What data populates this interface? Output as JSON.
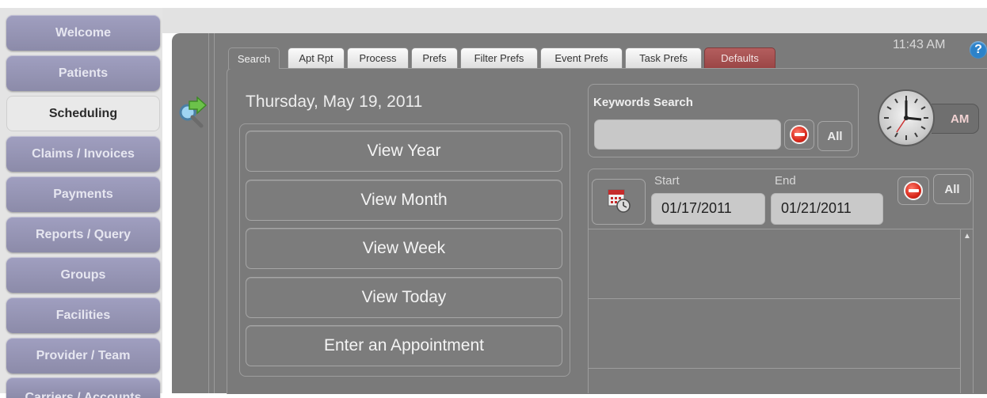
{
  "sidebar": {
    "items": [
      {
        "label": "Welcome"
      },
      {
        "label": "Patients"
      },
      {
        "label": "Scheduling"
      },
      {
        "label": "Claims / Invoices"
      },
      {
        "label": "Payments"
      },
      {
        "label": "Reports / Query"
      },
      {
        "label": "Groups"
      },
      {
        "label": "Facilities"
      },
      {
        "label": "Provider / Team"
      },
      {
        "label": "Carriers / Accounts"
      }
    ],
    "active": "Scheduling"
  },
  "header": {
    "time": "11:43 AM",
    "help_glyph": "?"
  },
  "tabs": [
    {
      "label": "Search"
    },
    {
      "label": "Apt Rpt"
    },
    {
      "label": "Process"
    },
    {
      "label": "Prefs"
    },
    {
      "label": "Filter Prefs"
    },
    {
      "label": "Event Prefs"
    },
    {
      "label": "Task Prefs"
    },
    {
      "label": "Defaults"
    }
  ],
  "main": {
    "date": "Thursday, May 19, 2011",
    "view_buttons": [
      "View Year",
      "View Month",
      "View Week",
      "View Today",
      "Enter an Appointment"
    ]
  },
  "keywords": {
    "label": "Keywords Search",
    "value": "",
    "all_label": "All"
  },
  "clock": {
    "ampm_label": "AM"
  },
  "range": {
    "start_label": "Start",
    "start_value": "01/17/2011",
    "end_label": "End",
    "end_value": "01/21/2011",
    "all_label": "All"
  },
  "colors": {
    "panel": "#7b7b7b",
    "nav_button": "#9b9aba",
    "active_nav": "#e9e9e9",
    "defaults_tab": "#a94f4f",
    "help": "#2d82c9"
  },
  "icons": [
    "search-arrow-icon",
    "help-icon",
    "minus-icon",
    "clock-icon",
    "calendar-clock-icon",
    "scroll-up-icon"
  ]
}
